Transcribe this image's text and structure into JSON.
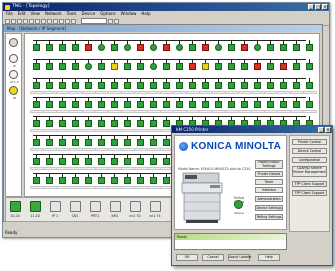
{
  "main_window": {
    "title": "TNG - [Topology]",
    "menu": [
      "File",
      "Edit",
      "View",
      "Network",
      "Tools",
      "Device",
      "Options",
      "Window",
      "Help"
    ],
    "child_title": "Map - [Network / IP Segment]",
    "status": "Ready"
  },
  "left_strip": {
    "labels": [
      "IP",
      "IP 1.2",
      "ID"
    ]
  },
  "bottom_bar": {
    "devices": [
      "10.20",
      "11.20",
      "IP 1",
      "CN1",
      "PRT1",
      "KM1",
      "cn1 70",
      "cn1 74"
    ]
  },
  "device_panel": {
    "title": "KM C250 Printer",
    "brand": "KONICA MINOLTA",
    "model_line": "Model Name: KONICA MINOLTA bizhub C250",
    "online_label": "Online Status",
    "online_text": "Online",
    "buttons": [
      "Paper/Output Settings",
      "Printer Details",
      "Toner",
      "Interface",
      "Administration",
      "Device Settings",
      "Polling Settings"
    ],
    "side_buttons": [
      "Printer Control",
      "Device Control",
      "Configuration",
      "LDAP/ID Search Printer Management",
      "TPP Client Support",
      "TPP Client Support"
    ],
    "ready_text": "Ready",
    "footer_buttons": [
      "OK",
      "Cancel",
      "Apply Update",
      "Help"
    ]
  },
  "colors": {
    "green": "#2ea23a",
    "red": "#d8301e",
    "yellow": "#ecd412",
    "brand_blue": "#0a46b5"
  }
}
